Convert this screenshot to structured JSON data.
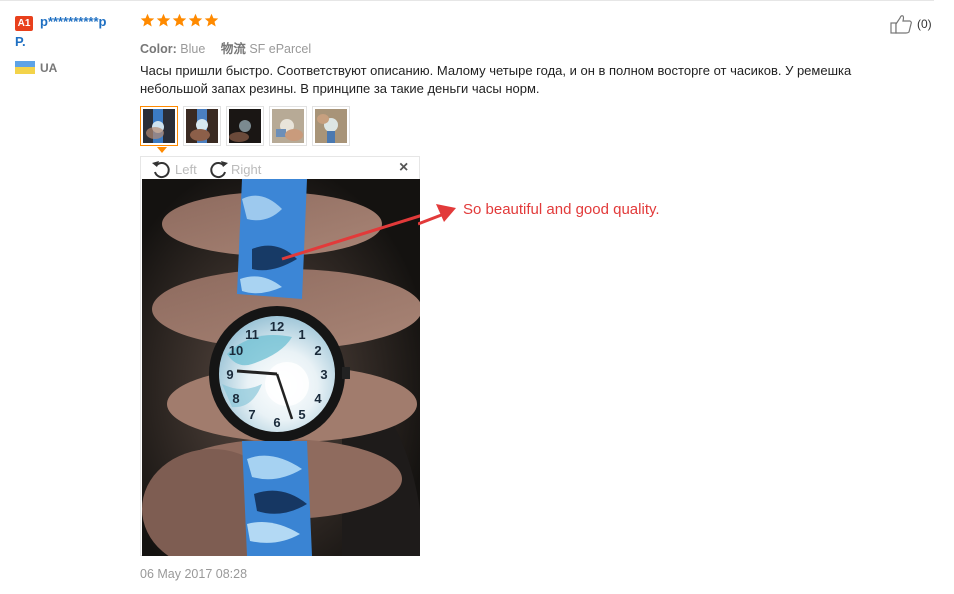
{
  "user": {
    "level_badge": "A1",
    "name_line1": "p**********p",
    "name_line2": "P.",
    "country": "UA"
  },
  "rating": {
    "stars": 5,
    "color": "#ff8a00"
  },
  "attributes": [
    {
      "label": "Color:",
      "value": "Blue"
    },
    {
      "label": "物流",
      "value": "SF eParcel"
    }
  ],
  "review_text": "Часы пришли быстро. Соответствуют описанию. Малому четыре года, и он в полном восторге от часиков. У ремешка небольшой запах резины. В принципе за такие деньги часы норм.",
  "helpful": {
    "count": "(0)"
  },
  "thumbnails": [
    {
      "selected": true
    },
    {
      "selected": false
    },
    {
      "selected": false
    },
    {
      "selected": false
    },
    {
      "selected": false
    }
  ],
  "viewer": {
    "rotate_left": "Left",
    "rotate_right": "Right",
    "close": "×",
    "annotation": "So beautiful and good quality."
  },
  "date": "06 May 2017 08:28"
}
